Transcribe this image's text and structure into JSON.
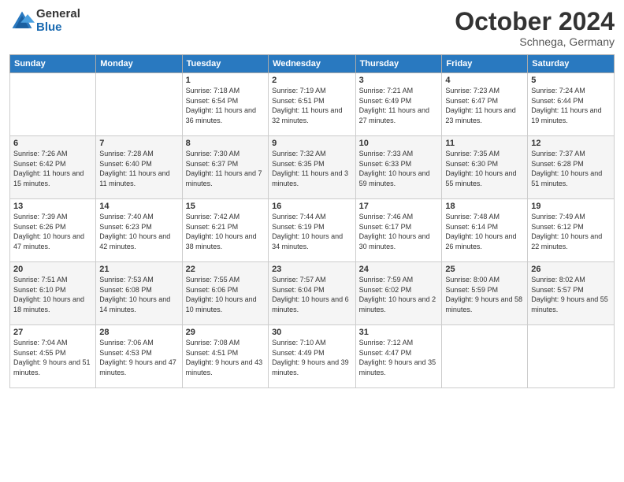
{
  "logo": {
    "general": "General",
    "blue": "Blue"
  },
  "header": {
    "month": "October 2024",
    "location": "Schnega, Germany"
  },
  "days_of_week": [
    "Sunday",
    "Monday",
    "Tuesday",
    "Wednesday",
    "Thursday",
    "Friday",
    "Saturday"
  ],
  "weeks": [
    [
      {
        "day": "",
        "info": ""
      },
      {
        "day": "",
        "info": ""
      },
      {
        "day": "1",
        "info": "Sunrise: 7:18 AM\nSunset: 6:54 PM\nDaylight: 11 hours and 36 minutes."
      },
      {
        "day": "2",
        "info": "Sunrise: 7:19 AM\nSunset: 6:51 PM\nDaylight: 11 hours and 32 minutes."
      },
      {
        "day": "3",
        "info": "Sunrise: 7:21 AM\nSunset: 6:49 PM\nDaylight: 11 hours and 27 minutes."
      },
      {
        "day": "4",
        "info": "Sunrise: 7:23 AM\nSunset: 6:47 PM\nDaylight: 11 hours and 23 minutes."
      },
      {
        "day": "5",
        "info": "Sunrise: 7:24 AM\nSunset: 6:44 PM\nDaylight: 11 hours and 19 minutes."
      }
    ],
    [
      {
        "day": "6",
        "info": "Sunrise: 7:26 AM\nSunset: 6:42 PM\nDaylight: 11 hours and 15 minutes."
      },
      {
        "day": "7",
        "info": "Sunrise: 7:28 AM\nSunset: 6:40 PM\nDaylight: 11 hours and 11 minutes."
      },
      {
        "day": "8",
        "info": "Sunrise: 7:30 AM\nSunset: 6:37 PM\nDaylight: 11 hours and 7 minutes."
      },
      {
        "day": "9",
        "info": "Sunrise: 7:32 AM\nSunset: 6:35 PM\nDaylight: 11 hours and 3 minutes."
      },
      {
        "day": "10",
        "info": "Sunrise: 7:33 AM\nSunset: 6:33 PM\nDaylight: 10 hours and 59 minutes."
      },
      {
        "day": "11",
        "info": "Sunrise: 7:35 AM\nSunset: 6:30 PM\nDaylight: 10 hours and 55 minutes."
      },
      {
        "day": "12",
        "info": "Sunrise: 7:37 AM\nSunset: 6:28 PM\nDaylight: 10 hours and 51 minutes."
      }
    ],
    [
      {
        "day": "13",
        "info": "Sunrise: 7:39 AM\nSunset: 6:26 PM\nDaylight: 10 hours and 47 minutes."
      },
      {
        "day": "14",
        "info": "Sunrise: 7:40 AM\nSunset: 6:23 PM\nDaylight: 10 hours and 42 minutes."
      },
      {
        "day": "15",
        "info": "Sunrise: 7:42 AM\nSunset: 6:21 PM\nDaylight: 10 hours and 38 minutes."
      },
      {
        "day": "16",
        "info": "Sunrise: 7:44 AM\nSunset: 6:19 PM\nDaylight: 10 hours and 34 minutes."
      },
      {
        "day": "17",
        "info": "Sunrise: 7:46 AM\nSunset: 6:17 PM\nDaylight: 10 hours and 30 minutes."
      },
      {
        "day": "18",
        "info": "Sunrise: 7:48 AM\nSunset: 6:14 PM\nDaylight: 10 hours and 26 minutes."
      },
      {
        "day": "19",
        "info": "Sunrise: 7:49 AM\nSunset: 6:12 PM\nDaylight: 10 hours and 22 minutes."
      }
    ],
    [
      {
        "day": "20",
        "info": "Sunrise: 7:51 AM\nSunset: 6:10 PM\nDaylight: 10 hours and 18 minutes."
      },
      {
        "day": "21",
        "info": "Sunrise: 7:53 AM\nSunset: 6:08 PM\nDaylight: 10 hours and 14 minutes."
      },
      {
        "day": "22",
        "info": "Sunrise: 7:55 AM\nSunset: 6:06 PM\nDaylight: 10 hours and 10 minutes."
      },
      {
        "day": "23",
        "info": "Sunrise: 7:57 AM\nSunset: 6:04 PM\nDaylight: 10 hours and 6 minutes."
      },
      {
        "day": "24",
        "info": "Sunrise: 7:59 AM\nSunset: 6:02 PM\nDaylight: 10 hours and 2 minutes."
      },
      {
        "day": "25",
        "info": "Sunrise: 8:00 AM\nSunset: 5:59 PM\nDaylight: 9 hours and 58 minutes."
      },
      {
        "day": "26",
        "info": "Sunrise: 8:02 AM\nSunset: 5:57 PM\nDaylight: 9 hours and 55 minutes."
      }
    ],
    [
      {
        "day": "27",
        "info": "Sunrise: 7:04 AM\nSunset: 4:55 PM\nDaylight: 9 hours and 51 minutes."
      },
      {
        "day": "28",
        "info": "Sunrise: 7:06 AM\nSunset: 4:53 PM\nDaylight: 9 hours and 47 minutes."
      },
      {
        "day": "29",
        "info": "Sunrise: 7:08 AM\nSunset: 4:51 PM\nDaylight: 9 hours and 43 minutes."
      },
      {
        "day": "30",
        "info": "Sunrise: 7:10 AM\nSunset: 4:49 PM\nDaylight: 9 hours and 39 minutes."
      },
      {
        "day": "31",
        "info": "Sunrise: 7:12 AM\nSunset: 4:47 PM\nDaylight: 9 hours and 35 minutes."
      },
      {
        "day": "",
        "info": ""
      },
      {
        "day": "",
        "info": ""
      }
    ]
  ]
}
